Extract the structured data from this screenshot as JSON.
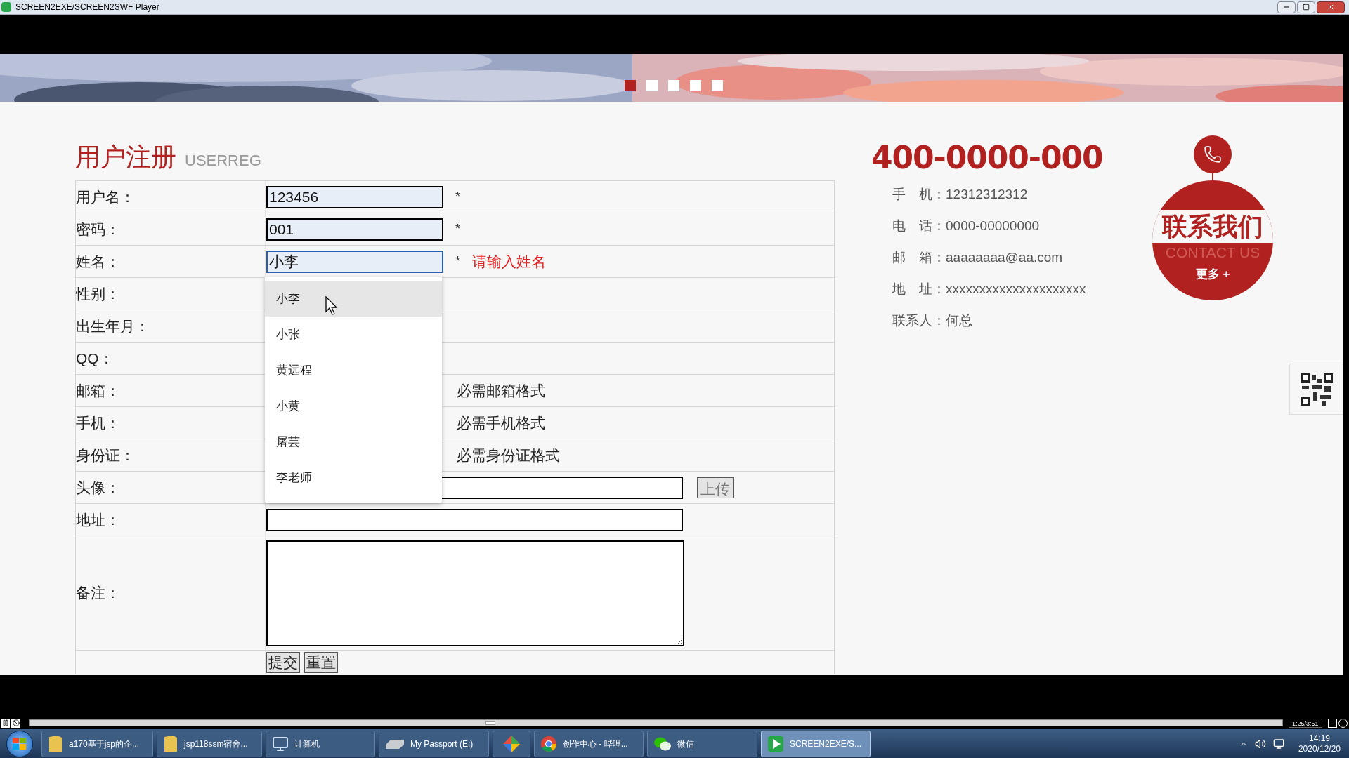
{
  "window": {
    "title": "SCREEN2EXE/SCREEN2SWF Player"
  },
  "banner": {
    "slides": [
      {
        "selected": true
      },
      {
        "selected": false
      },
      {
        "selected": false
      },
      {
        "selected": false
      },
      {
        "selected": false
      }
    ]
  },
  "form": {
    "title": "用户注册",
    "subtitle": "USERREG",
    "rows": [
      {
        "label": "用户名：",
        "kind": "input",
        "value": "123456",
        "focused": false,
        "required": "*"
      },
      {
        "label": "密码：",
        "kind": "input",
        "value": "001",
        "focused": false,
        "required": "*"
      },
      {
        "label": "姓名：",
        "kind": "input",
        "value": "小李",
        "focused": true,
        "required": "*",
        "error": "请输入姓名"
      },
      {
        "label": "性别：",
        "kind": "blank"
      },
      {
        "label": "出生年月：",
        "kind": "blank"
      },
      {
        "label": "QQ：",
        "kind": "blank"
      },
      {
        "label": "邮箱：",
        "kind": "hint",
        "hint": "必需邮箱格式"
      },
      {
        "label": "手机：",
        "kind": "hint",
        "hint": "必需手机格式"
      },
      {
        "label": "身份证：",
        "kind": "hint",
        "hint": "必需身份证格式"
      },
      {
        "label": "头像：",
        "kind": "file",
        "button": "上传"
      },
      {
        "label": "地址：",
        "kind": "wide_input"
      },
      {
        "label": "备注：",
        "kind": "textarea"
      },
      {
        "kind": "buttons",
        "buttons": [
          "提交",
          "重置"
        ]
      }
    ]
  },
  "suggestions": {
    "items": [
      {
        "label": "小李",
        "selected": true
      },
      {
        "label": "小张",
        "selected": false
      },
      {
        "label": "黄远程",
        "selected": false
      },
      {
        "label": "小黄",
        "selected": false
      },
      {
        "label": "屠芸",
        "selected": false
      },
      {
        "label": "李老师",
        "selected": false
      }
    ]
  },
  "contact": {
    "hotline": "400-0000-000",
    "lines": [
      "手　机：12312312312",
      "电　话：0000-00000000",
      "邮　箱：aaaaaaaa@aa.com",
      "地　址：xxxxxxxxxxxxxxxxxxxxx",
      "联系人：何总"
    ],
    "badge": {
      "heading": "联系我们",
      "subheading": "CONTACT US",
      "more": "更多 +"
    }
  },
  "player": {
    "level": 0.368,
    "time": "1:25/3:51"
  },
  "taskbar": {
    "items": [
      {
        "label": "a170基于jsp的企...",
        "selected": false
      },
      {
        "label": "jsp118ssm宿舍...",
        "selected": false
      },
      {
        "label": "计算机",
        "selected": false
      },
      {
        "label": "My Passport (E:)",
        "selected": false
      },
      {
        "selected": false
      },
      {
        "label": "创作中心 - 哔哩...",
        "selected": false
      },
      {
        "label": "微信",
        "selected": false
      },
      {
        "label": "SCREEN2EXE/S...",
        "selected": true
      }
    ],
    "time": "14:19",
    "date": "2020/12/20"
  }
}
